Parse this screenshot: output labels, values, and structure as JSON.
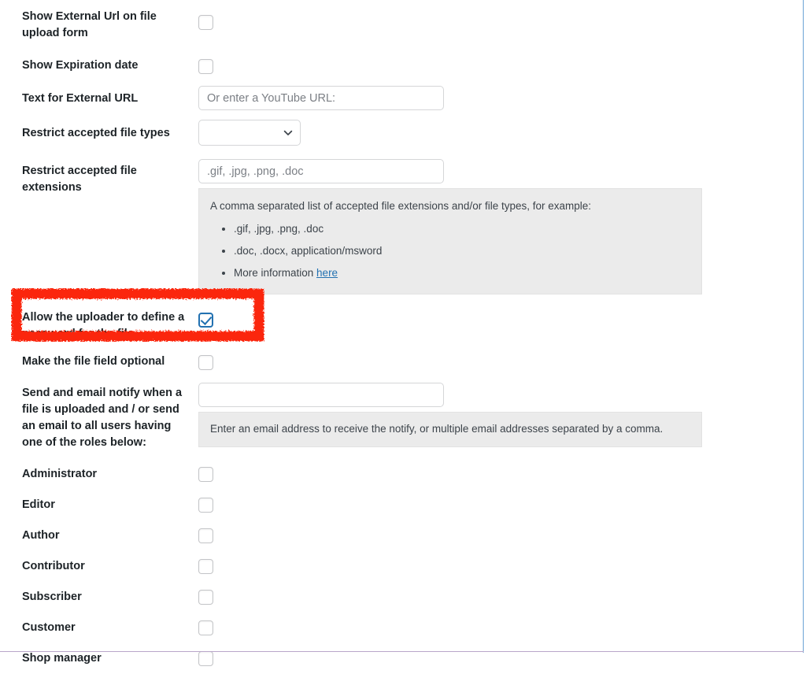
{
  "form": {
    "rows": [
      {
        "id": "show-external-url",
        "label": "Show External Url on file upload form",
        "control": "checkbox",
        "checked": false
      },
      {
        "id": "show-expiration-date",
        "label": "Show Expiration date",
        "control": "checkbox",
        "checked": false
      },
      {
        "id": "text-for-external-url",
        "label": "Text for External URL",
        "control": "text",
        "value": "",
        "placeholder": "Or enter a YouTube URL:"
      },
      {
        "id": "restrict-accepted-file-types",
        "label": "Restrict accepted file types",
        "control": "select",
        "selected": ""
      },
      {
        "id": "restrict-accepted-file-extensions",
        "label": "Restrict accepted file extensions",
        "control": "text",
        "value": "",
        "placeholder": ".gif, .jpg, .png, .doc"
      },
      {
        "id": "allow-password",
        "label": "Allow the uploader to define a password for the file",
        "control": "checkbox",
        "checked": true,
        "highlighted": true
      },
      {
        "id": "make-file-field-optional",
        "label": "Make the file field optional",
        "control": "checkbox",
        "checked": false
      },
      {
        "id": "email-notify",
        "label": "Send and email notify when a file is uploaded and / or send an email to all users having one of the roles below:",
        "control": "text",
        "value": "",
        "placeholder": ""
      }
    ],
    "extensions_help": {
      "intro": "A comma separated list of accepted file extensions and/or file types, for example:",
      "items": [
        ".gif, .jpg, .png, .doc",
        ".doc, .docx, application/msword"
      ],
      "more_info_prefix": "More information ",
      "more_info_link": "here"
    },
    "email_help": "Enter an email address to receive the notify, or multiple email addresses separated by a comma.",
    "roles": [
      {
        "id": "administrator",
        "label": "Administrator",
        "checked": false
      },
      {
        "id": "editor",
        "label": "Editor",
        "checked": false
      },
      {
        "id": "author",
        "label": "Author",
        "checked": false
      },
      {
        "id": "contributor",
        "label": "Contributor",
        "checked": false
      },
      {
        "id": "subscriber",
        "label": "Subscriber",
        "checked": false
      },
      {
        "id": "customer",
        "label": "Customer",
        "checked": false
      },
      {
        "id": "shop-manager",
        "label": "Shop manager",
        "checked": false
      }
    ]
  },
  "annotation": {
    "type": "rectangle-highlight",
    "color": "#fb2507",
    "targets": "allow-password"
  },
  "colors": {
    "accent": "#2271b1",
    "label_text": "#1d2327",
    "body_text": "#3c434a",
    "placeholder": "#7b7f85",
    "help_bg": "#ebebeb",
    "input_border": "#d5d6d8",
    "checkbox_border": "#c3c4c7",
    "annotation_red": "#fb2507",
    "right_rule": "#6ba3d6",
    "bottom_rule": "#b9a6c9"
  }
}
